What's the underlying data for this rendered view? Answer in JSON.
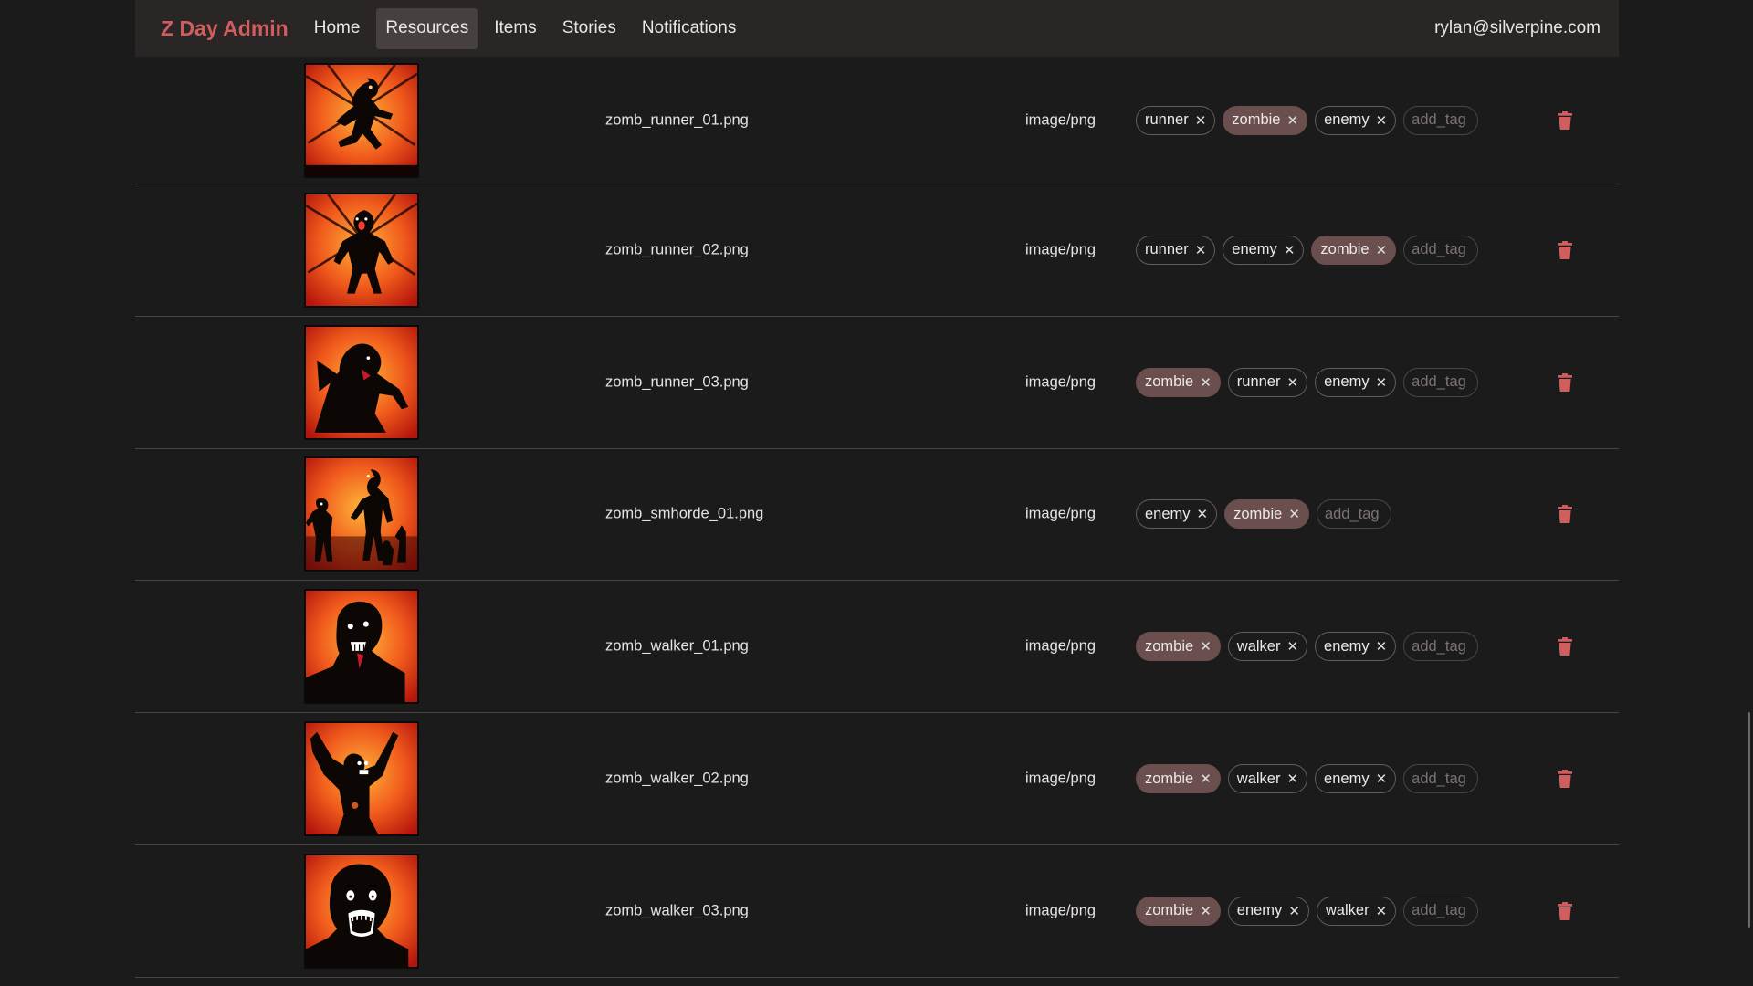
{
  "app": {
    "brand": "Z Day Admin",
    "user_email": "rylan@silverpine.com",
    "nav": [
      {
        "label": "Home",
        "active": false
      },
      {
        "label": "Resources",
        "active": true
      },
      {
        "label": "Items",
        "active": false
      },
      {
        "label": "Stories",
        "active": false
      },
      {
        "label": "Notifications",
        "active": false
      }
    ],
    "colors": {
      "accent": "#d05e5e",
      "tag_highlight": "#6b4e4e",
      "background": "#1c1b1b",
      "navbar": "#2a2626"
    }
  },
  "resources": [
    {
      "filename": "zomb_runner_01.png",
      "mime": "image/png",
      "art": "runner1",
      "tags": [
        {
          "label": "runner",
          "hl": false
        },
        {
          "label": "zombie",
          "hl": true
        },
        {
          "label": "enemy",
          "hl": false
        }
      ],
      "tag_placeholder": "add_tag",
      "delete_icon": "trash-icon"
    },
    {
      "filename": "zomb_runner_02.png",
      "mime": "image/png",
      "art": "runner2",
      "tags": [
        {
          "label": "runner",
          "hl": false
        },
        {
          "label": "enemy",
          "hl": false
        },
        {
          "label": "zombie",
          "hl": true
        }
      ],
      "tag_placeholder": "add_tag",
      "delete_icon": "trash-icon"
    },
    {
      "filename": "zomb_runner_03.png",
      "mime": "image/png",
      "art": "runner3",
      "tags": [
        {
          "label": "zombie",
          "hl": true
        },
        {
          "label": "runner",
          "hl": false
        },
        {
          "label": "enemy",
          "hl": false
        }
      ],
      "tag_placeholder": "add_tag",
      "delete_icon": "trash-icon"
    },
    {
      "filename": "zomb_smhorde_01.png",
      "mime": "image/png",
      "art": "horde1",
      "tags": [
        {
          "label": "enemy",
          "hl": false
        },
        {
          "label": "zombie",
          "hl": true
        }
      ],
      "tag_placeholder": "add_tag",
      "delete_icon": "trash-icon"
    },
    {
      "filename": "zomb_walker_01.png",
      "mime": "image/png",
      "art": "walker1",
      "tags": [
        {
          "label": "zombie",
          "hl": true
        },
        {
          "label": "walker",
          "hl": false
        },
        {
          "label": "enemy",
          "hl": false
        }
      ],
      "tag_placeholder": "add_tag",
      "delete_icon": "trash-icon"
    },
    {
      "filename": "zomb_walker_02.png",
      "mime": "image/png",
      "art": "walker2",
      "tags": [
        {
          "label": "zombie",
          "hl": true
        },
        {
          "label": "walker",
          "hl": false
        },
        {
          "label": "enemy",
          "hl": false
        }
      ],
      "tag_placeholder": "add_tag",
      "delete_icon": "trash-icon"
    },
    {
      "filename": "zomb_walker_03.png",
      "mime": "image/png",
      "art": "walker3",
      "tags": [
        {
          "label": "zombie",
          "hl": true
        },
        {
          "label": "enemy",
          "hl": false
        },
        {
          "label": "walker",
          "hl": false
        }
      ],
      "tag_placeholder": "add_tag",
      "delete_icon": "trash-icon"
    }
  ]
}
